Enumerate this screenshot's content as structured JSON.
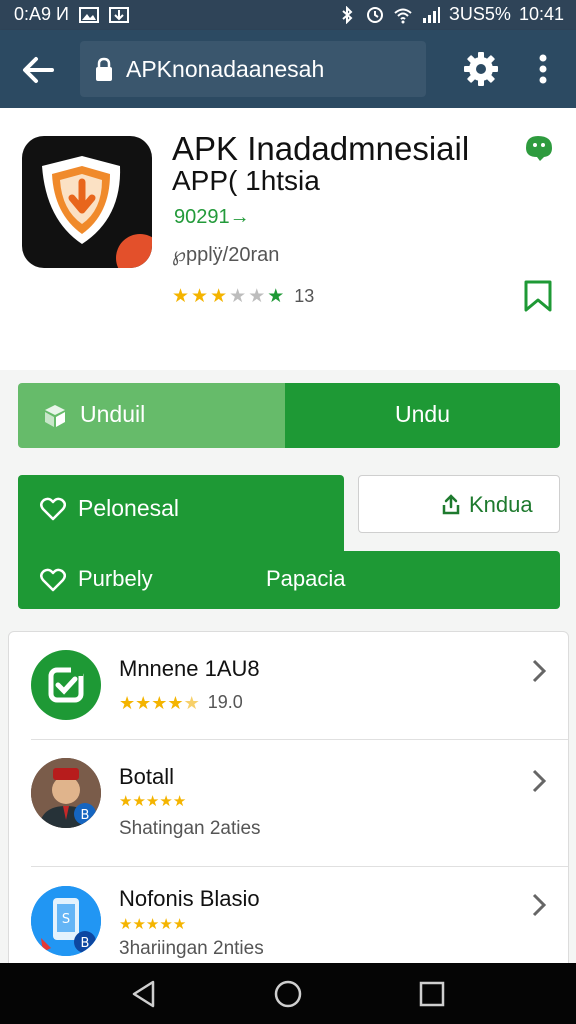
{
  "status_bar": {
    "left_text": "0:A9 И",
    "battery_text": "ЗUS5%",
    "time": "10:41",
    "icons": [
      "image-icon",
      "download-icon",
      "bluetooth-icon",
      "clock-icon",
      "wifi-icon",
      "signal-icon"
    ]
  },
  "toolbar": {
    "url": "APKnonadaanesah",
    "icons": [
      "back-arrow-icon",
      "lock-icon",
      "gear-icon",
      "more-vertical-icon"
    ]
  },
  "app": {
    "title": "APK Inadadmnesiail",
    "subtitle": "APP( 1htsia",
    "rating_text": "90291→",
    "meta": "℘pplÿ/20ran",
    "stars_filled": 3,
    "stars_total": 6,
    "rating_count": "13",
    "colors": {
      "brand_green": "#1e9935",
      "light_green": "#66bb6a",
      "star_gold": "#f4b400",
      "app_bar": "#2c4a62"
    }
  },
  "download": {
    "left_label": "Unduil",
    "right_label": "Undu"
  },
  "actions": {
    "primary_label": "Pelonesal",
    "secondary_label": "Kndua",
    "bottom_left_label": "Purbely",
    "bottom_right_label": "Papacia"
  },
  "related": [
    {
      "title": "Mnnene 1AU8",
      "stars": 4.5,
      "count": "19.0",
      "subtitle": ""
    },
    {
      "title": "Botall",
      "stars": 5,
      "count": "",
      "subtitle": "Shatingan 2aties"
    },
    {
      "title": "Nofonis Blasio",
      "stars": 5,
      "count": "",
      "subtitle": "3hariingan 2nties"
    }
  ],
  "nav": {
    "icons": [
      "back-triangle-icon",
      "home-circle-icon",
      "recents-square-icon"
    ]
  }
}
